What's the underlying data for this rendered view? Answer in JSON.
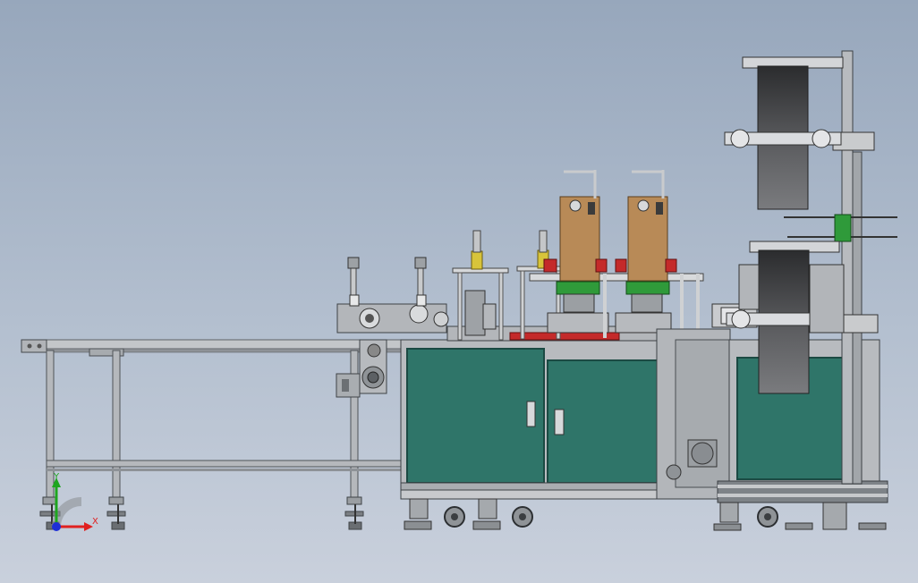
{
  "viewport": {
    "description_mode": "cad-3d-view",
    "background_top": "#97a7bc",
    "background_bottom": "#c9d0dc"
  },
  "colors": {
    "frame": "#b9bcc0",
    "frame_dark": "#6d7277",
    "cabinet_panel": "#2f7569",
    "cabinet_edge": "#1b4a43",
    "reel": "#3c3d3f",
    "wood_plate": "#b88a57",
    "red_rail": "#c42a2a",
    "green_part": "#2f9a3a",
    "yellow_part": "#d8c43a",
    "axis_x": "#e02020",
    "axis_y": "#1fa51f",
    "axis_z": "#1e2fd6"
  },
  "triad": {
    "x_label": "X",
    "y_label": "Y"
  }
}
